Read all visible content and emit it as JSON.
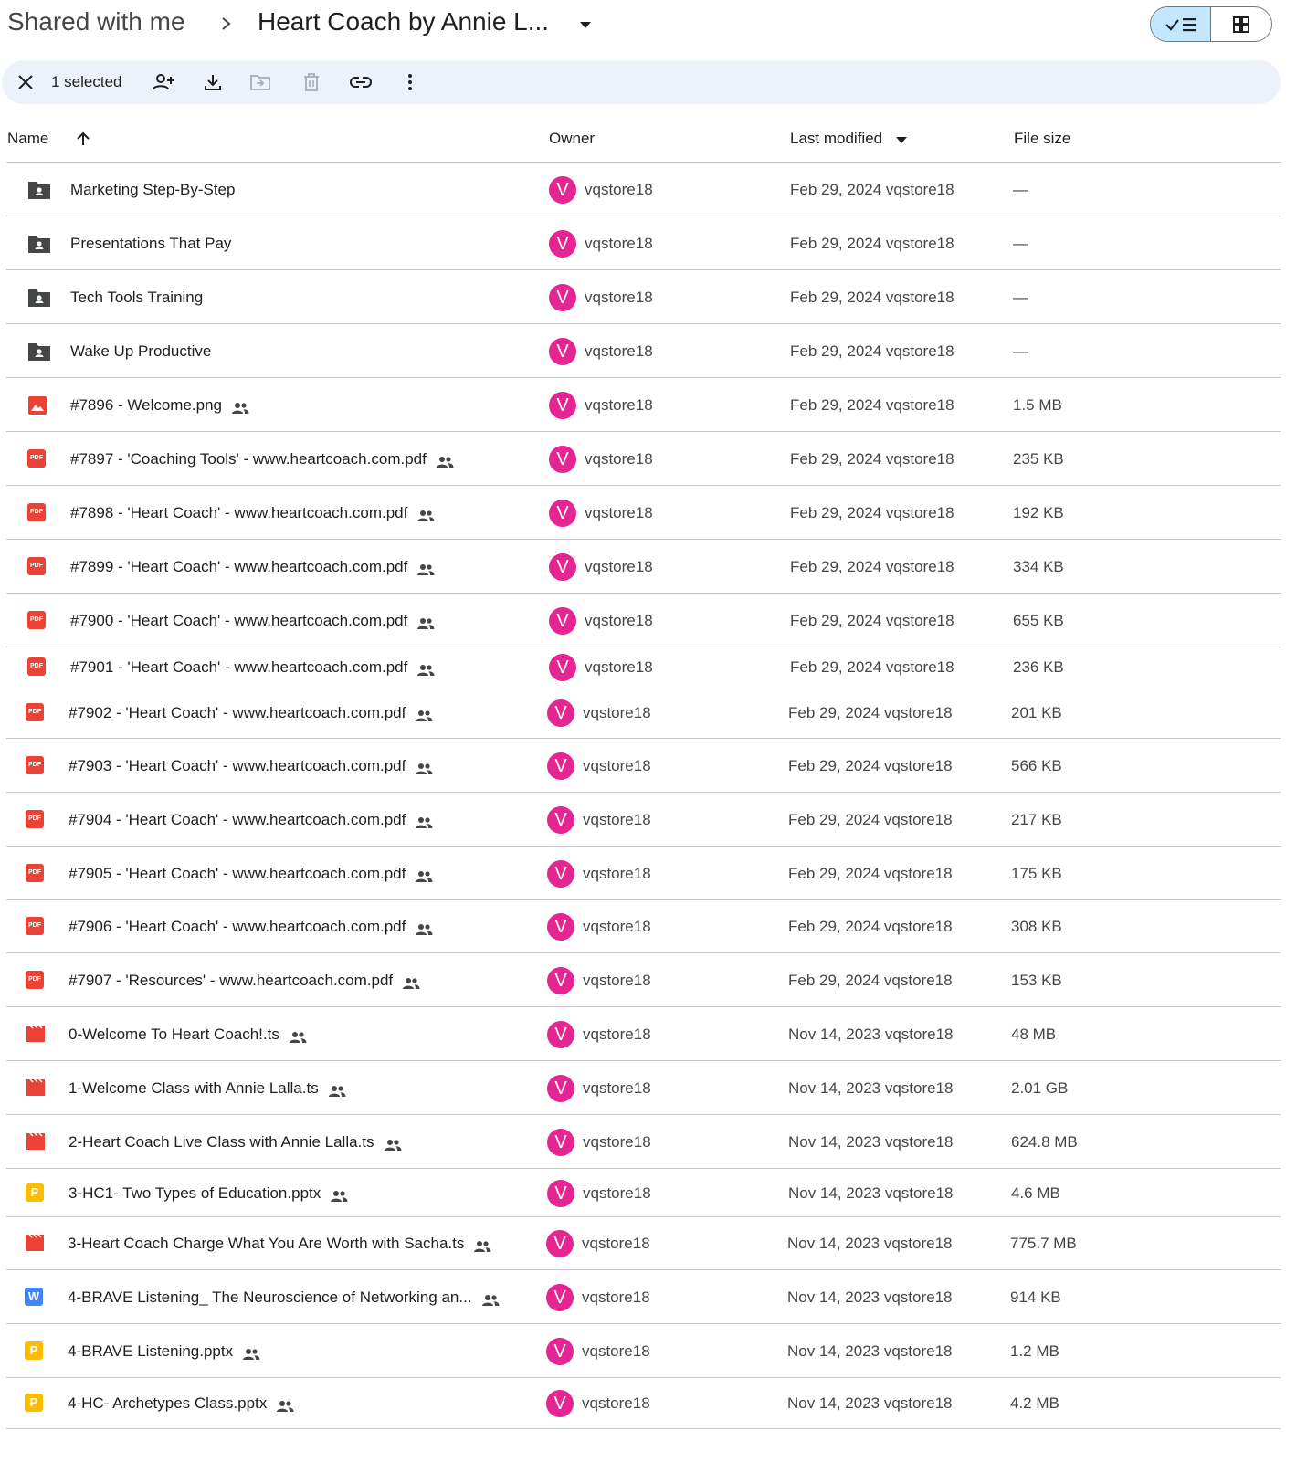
{
  "breadcrumb": {
    "root": "Shared with me",
    "current": "Heart Coach by Annie L..."
  },
  "toolbar": {
    "selected_count": "1 selected"
  },
  "columns": {
    "name": "Name",
    "owner": "Owner",
    "last_modified": "Last modified",
    "file_size": "File size"
  },
  "colors": {
    "accent": "#c2e7ff",
    "toolbar_bg": "#edf2fa",
    "avatar": "#e52592",
    "pdf": "#ea4335",
    "slides": "#fbbc04",
    "docs": "#4285f4",
    "video": "#ea4335"
  },
  "files": [
    {
      "type": "folder-icon",
      "name": "Marketing Step-By-Step",
      "shared": false,
      "owner_initial": "V",
      "owner": "vqstore18",
      "modified": "Feb 29, 2024 vqstore18",
      "size": "—"
    },
    {
      "type": "folder-icon",
      "name": "Presentations That Pay",
      "shared": false,
      "owner_initial": "V",
      "owner": "vqstore18",
      "modified": "Feb 29, 2024 vqstore18",
      "size": "—"
    },
    {
      "type": "folder-icon",
      "name": "Tech Tools Training",
      "shared": false,
      "owner_initial": "V",
      "owner": "vqstore18",
      "modified": "Feb 29, 2024 vqstore18",
      "size": "—"
    },
    {
      "type": "folder-icon",
      "name": "Wake Up Productive",
      "shared": false,
      "owner_initial": "V",
      "owner": "vqstore18",
      "modified": "Feb 29, 2024 vqstore18",
      "size": "—"
    },
    {
      "type": "image-icon",
      "name": "#7896 - Welcome.png",
      "shared": true,
      "owner_initial": "V",
      "owner": "vqstore18",
      "modified": "Feb 29, 2024 vqstore18",
      "size": "1.5 MB"
    },
    {
      "type": "pdf-icon",
      "name": "#7897 - 'Coaching Tools' - www.heartcoach.com.pdf",
      "shared": true,
      "owner_initial": "V",
      "owner": "vqstore18",
      "modified": "Feb 29, 2024 vqstore18",
      "size": "235 KB"
    },
    {
      "type": "pdf-icon",
      "name": "#7898 - 'Heart Coach' - www.heartcoach.com.pdf",
      "shared": true,
      "owner_initial": "V",
      "owner": "vqstore18",
      "modified": "Feb 29, 2024 vqstore18",
      "size": "192 KB"
    },
    {
      "type": "pdf-icon",
      "name": "#7899 - 'Heart Coach' - www.heartcoach.com.pdf",
      "shared": true,
      "owner_initial": "V",
      "owner": "vqstore18",
      "modified": "Feb 29, 2024 vqstore18",
      "size": "334 KB"
    },
    {
      "type": "pdf-icon",
      "name": "#7900 - 'Heart Coach' - www.heartcoach.com.pdf",
      "shared": true,
      "owner_initial": "V",
      "owner": "vqstore18",
      "modified": "Feb 29, 2024 vqstore18",
      "size": "655 KB"
    },
    {
      "type": "pdf-icon",
      "name": "#7901 - 'Heart Coach' - www.heartcoach.com.pdf",
      "shared": true,
      "owner_initial": "V",
      "owner": "vqstore18",
      "modified": "Feb 29, 2024 vqstore18",
      "size": "236 KB"
    },
    {
      "type": "pdf-icon",
      "name": "#7902 - 'Heart Coach' - www.heartcoach.com.pdf",
      "shared": true,
      "owner_initial": "V",
      "owner": "vqstore18",
      "modified": "Feb 29, 2024 vqstore18",
      "size": "201 KB"
    },
    {
      "type": "pdf-icon",
      "name": "#7903 - 'Heart Coach' - www.heartcoach.com.pdf",
      "shared": true,
      "owner_initial": "V",
      "owner": "vqstore18",
      "modified": "Feb 29, 2024 vqstore18",
      "size": "566 KB"
    },
    {
      "type": "pdf-icon",
      "name": "#7904 - 'Heart Coach' - www.heartcoach.com.pdf",
      "shared": true,
      "owner_initial": "V",
      "owner": "vqstore18",
      "modified": "Feb 29, 2024 vqstore18",
      "size": "217 KB"
    },
    {
      "type": "pdf-icon",
      "name": "#7905 - 'Heart Coach' - www.heartcoach.com.pdf",
      "shared": true,
      "owner_initial": "V",
      "owner": "vqstore18",
      "modified": "Feb 29, 2024 vqstore18",
      "size": "175 KB"
    },
    {
      "type": "pdf-icon",
      "name": "#7906 - 'Heart Coach' - www.heartcoach.com.pdf",
      "shared": true,
      "owner_initial": "V",
      "owner": "vqstore18",
      "modified": "Feb 29, 2024 vqstore18",
      "size": "308 KB"
    },
    {
      "type": "pdf-icon",
      "name": "#7907 - 'Resources' - www.heartcoach.com.pdf",
      "shared": true,
      "owner_initial": "V",
      "owner": "vqstore18",
      "modified": "Feb 29, 2024 vqstore18",
      "size": "153 KB"
    },
    {
      "type": "video-icon",
      "name": "0-Welcome To Heart Coach!.ts",
      "shared": true,
      "owner_initial": "V",
      "owner": "vqstore18",
      "modified": "Nov 14, 2023 vqstore18",
      "size": "48 MB"
    },
    {
      "type": "video-icon",
      "name": "1-Welcome Class with Annie Lalla.ts",
      "shared": true,
      "owner_initial": "V",
      "owner": "vqstore18",
      "modified": "Nov 14, 2023 vqstore18",
      "size": "2.01 GB"
    },
    {
      "type": "video-icon",
      "name": "2-Heart Coach Live Class with Annie Lalla.ts",
      "shared": true,
      "owner_initial": "V",
      "owner": "vqstore18",
      "modified": "Nov 14, 2023 vqstore18",
      "size": "624.8 MB"
    },
    {
      "type": "slides-icon",
      "badge": "P",
      "name": "3-HC1- Two Types of Education.pptx",
      "shared": true,
      "owner_initial": "V",
      "owner": "vqstore18",
      "modified": "Nov 14, 2023 vqstore18",
      "size": "4.6 MB"
    },
    {
      "type": "video-icon",
      "name": "3-Heart Coach Charge What You Are Worth with Sacha.ts",
      "shared": true,
      "owner_initial": "V",
      "owner": "vqstore18",
      "modified": "Nov 14, 2023 vqstore18",
      "size": "775.7 MB"
    },
    {
      "type": "docs-icon",
      "badge": "W",
      "name": "4-BRAVE Listening_ The Neuroscience of Networking an...",
      "shared": true,
      "owner_initial": "V",
      "owner": "vqstore18",
      "modified": "Nov 14, 2023 vqstore18",
      "size": "914 KB"
    },
    {
      "type": "slides-icon",
      "badge": "P",
      "name": "4-BRAVE Listening.pptx",
      "shared": true,
      "owner_initial": "V",
      "owner": "vqstore18",
      "modified": "Nov 14, 2023 vqstore18",
      "size": "1.2 MB"
    },
    {
      "type": "slides-icon",
      "badge": "P",
      "name": "4-HC- Archetypes Class.pptx",
      "shared": true,
      "owner_initial": "V",
      "owner": "vqstore18",
      "modified": "Nov 14, 2023 vqstore18",
      "size": "4.2 MB"
    }
  ]
}
